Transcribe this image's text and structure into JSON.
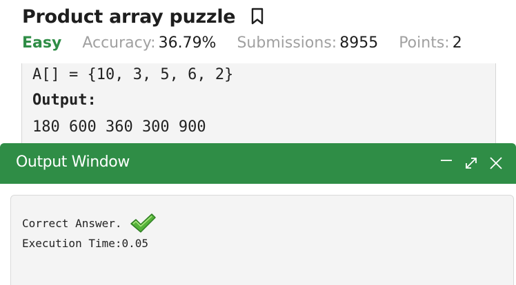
{
  "problem": {
    "title": "Product array puzzle",
    "difficulty": "Easy",
    "accuracy_label": "Accuracy:",
    "accuracy_value": "36.79%",
    "submissions_label": "Submissions:",
    "submissions_value": "8955",
    "points_label": "Points:",
    "points_value": "2"
  },
  "example": {
    "input_line": "A[] = {10, 3, 5, 6, 2}",
    "output_label": "Output:",
    "output_value": "180 600 360 300 900"
  },
  "output_window": {
    "title": "Output Window",
    "result_text": "Correct Answer.",
    "execution_time": "Execution Time:0.05"
  },
  "colors": {
    "accent": "#2f8d46",
    "panel_bg": "#f4f4f4"
  },
  "icons": {
    "bookmark": "bookmark-icon",
    "minimize": "minimize-icon",
    "expand": "expand-icon",
    "close": "close-icon",
    "check": "check-icon"
  }
}
